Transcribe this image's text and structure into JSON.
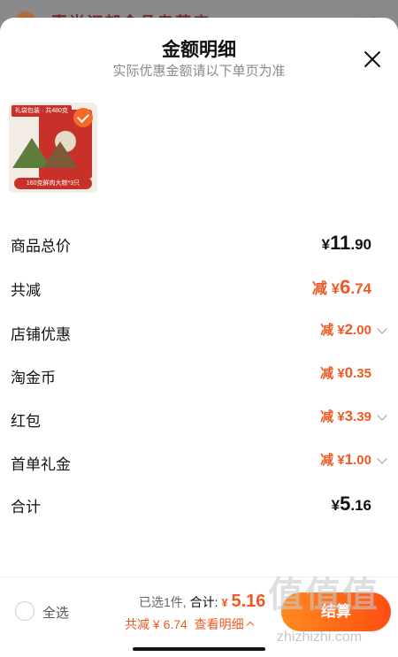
{
  "background": {
    "header_text": "惠尚订部食品专营店",
    "right_text": "运费"
  },
  "sheet": {
    "title": "金额明细",
    "subtitle": "实际优惠金额请以下单页为准"
  },
  "product": {
    "tag_top": "礼袋包装 · 共480克",
    "tag_bottom": "160克鲜肉大粽*3只",
    "selected": true
  },
  "rows": [
    {
      "label": "商品总价",
      "prefix": "¥",
      "int": "11",
      "dec": ".90",
      "style": "black",
      "size": "big",
      "has_chevron": false
    },
    {
      "label": "共减",
      "prefix": "减 ¥",
      "int": "6",
      "dec": ".74",
      "style": "orange",
      "size": "big",
      "has_chevron": false
    },
    {
      "label": "店铺优惠",
      "prefix": "减 ¥",
      "int": "2",
      "dec": ".00",
      "style": "orange",
      "size": "small",
      "has_chevron": true
    },
    {
      "label": "淘金币",
      "prefix": "减 ¥",
      "int": "0",
      "dec": ".35",
      "style": "orange",
      "size": "small",
      "has_chevron": false
    },
    {
      "label": "红包",
      "prefix": "减 ¥",
      "int": "3",
      "dec": ".39",
      "style": "orange",
      "size": "small",
      "has_chevron": true
    },
    {
      "label": "首单礼金",
      "prefix": "减 ¥",
      "int": "1",
      "dec": ".00",
      "style": "orange",
      "size": "small",
      "has_chevron": true
    },
    {
      "label": "合计",
      "prefix": "¥",
      "int": "5",
      "dec": ".16",
      "style": "black",
      "size": "big",
      "has_chevron": false
    }
  ],
  "bottom": {
    "select_all": "全选",
    "selected_count": "已选1件,",
    "total_label": "合计:",
    "total_prefix": "¥",
    "total_value": "5.16",
    "saved_text": "共减 ¥ 6.74",
    "detail_link": "查看明细",
    "checkout": "结算"
  },
  "watermark": {
    "big": "值值值",
    "url": "zhizhizhi.com"
  },
  "colors": {
    "accent": "#ee5a24",
    "checkout_gradient_start": "#ff8a1f",
    "checkout_gradient_end": "#ff4d12"
  }
}
